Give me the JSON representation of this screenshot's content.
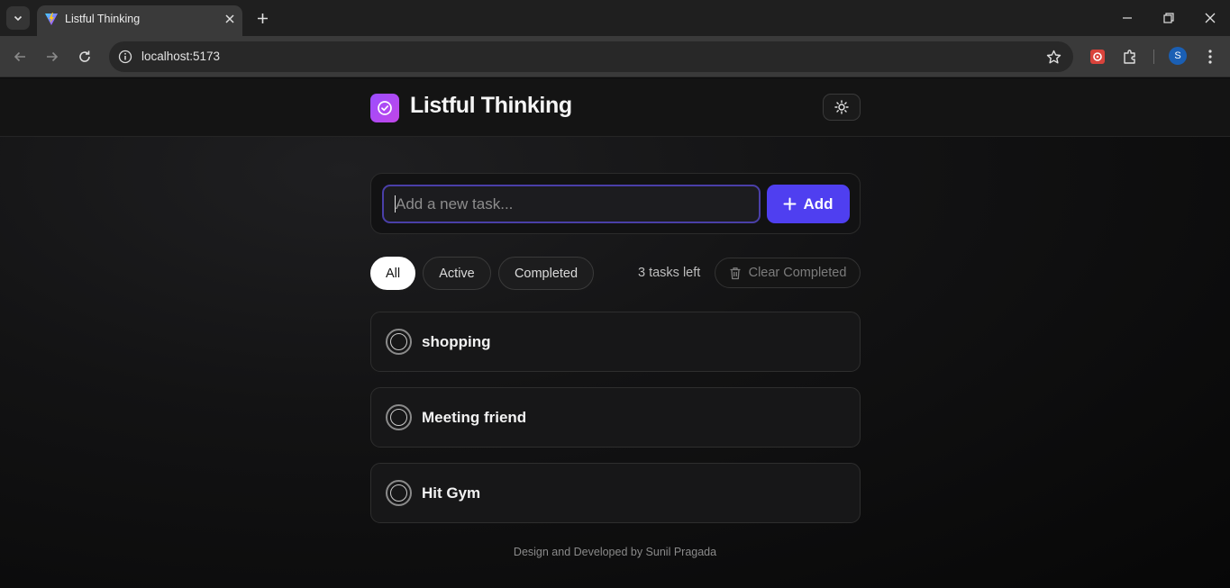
{
  "browser": {
    "tab_title": "Listful Thinking",
    "url": "localhost:5173",
    "profile_initial": "S"
  },
  "app": {
    "title": "Listful Thinking"
  },
  "add_task": {
    "placeholder": "Add a new task...",
    "value": "",
    "button_label": "Add"
  },
  "filters": [
    {
      "label": "All",
      "active": true
    },
    {
      "label": "Active",
      "active": false
    },
    {
      "label": "Completed",
      "active": false
    }
  ],
  "tasks_left": "3 tasks left",
  "clear_completed_label": "Clear Completed",
  "tasks": [
    {
      "text": "shopping",
      "completed": false
    },
    {
      "text": "Meeting friend",
      "completed": false
    },
    {
      "text": "Hit Gym",
      "completed": false
    }
  ],
  "footer": "Design and Developed by Sunil Pragada",
  "colors": {
    "accent": "#4f3ff0",
    "logo_gradient_start": "#9b4dff",
    "logo_gradient_end": "#c146e8",
    "page_background": "#0b0b0c"
  },
  "icons": {
    "logo": "check-circle-icon",
    "theme_toggle": "sun-icon",
    "add": "plus-icon",
    "clear": "trash-icon",
    "task_checkbox": "circle-icon"
  }
}
